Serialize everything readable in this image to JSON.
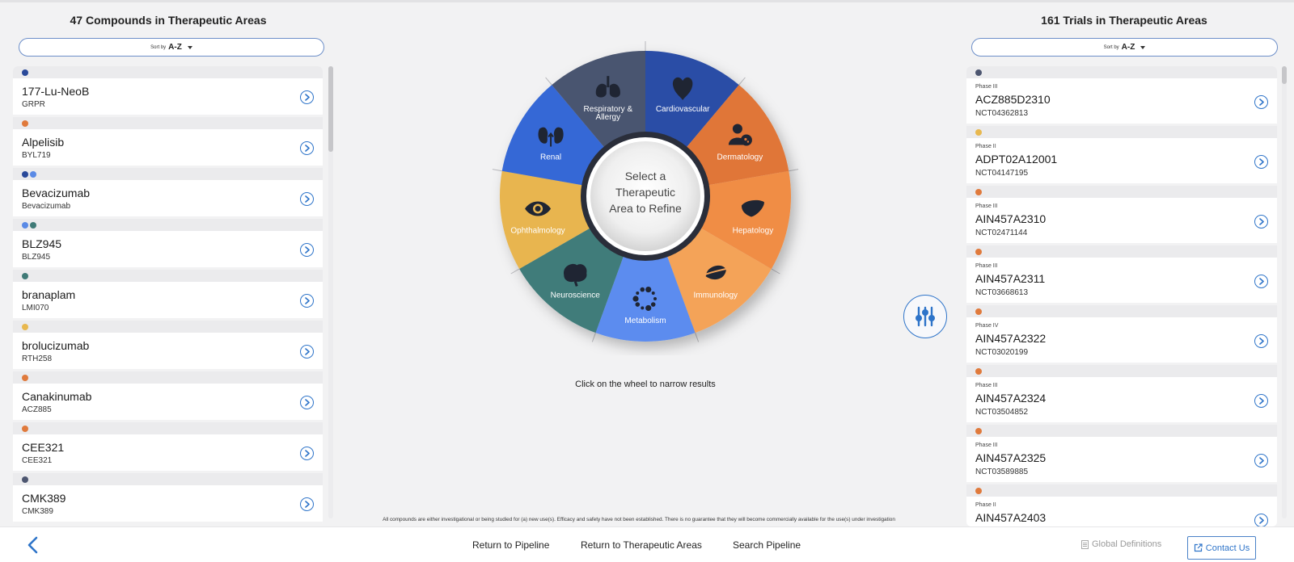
{
  "compounds": {
    "title": "47 Compounds in Therapeutic Areas",
    "sort_prefix": "Sort by",
    "sort_value": "A-Z",
    "items": [
      {
        "name": "177-Lu-NeoB",
        "code": "GRPR",
        "dots": [
          "#2a4a9a"
        ]
      },
      {
        "name": "Alpelisib",
        "code": "BYL719",
        "dots": [
          "#e07a3c"
        ]
      },
      {
        "name": "Bevacizumab",
        "code": "Bevacizumab",
        "dots": [
          "#2a4a9a",
          "#5a8ae6"
        ]
      },
      {
        "name": "BLZ945",
        "code": "BLZ945",
        "dots": [
          "#5a8ae6",
          "#3f7a77"
        ]
      },
      {
        "name": "branaplam",
        "code": "LMI070",
        "dots": [
          "#3f7a77"
        ]
      },
      {
        "name": "brolucizumab",
        "code": "RTH258",
        "dots": [
          "#e8b84f"
        ]
      },
      {
        "name": "Canakinumab",
        "code": "ACZ885",
        "dots": [
          "#e07a3c"
        ]
      },
      {
        "name": "CEE321",
        "code": "CEE321",
        "dots": [
          "#e07a3c"
        ]
      },
      {
        "name": "CMK389",
        "code": "CMK389",
        "dots": [
          "#4d5670"
        ]
      }
    ]
  },
  "trials": {
    "title": "161 Trials in Therapeutic Areas",
    "sort_prefix": "Sort by",
    "sort_value": "A-Z",
    "items": [
      {
        "phase": "Phase III",
        "name": "ACZ885D2310",
        "nct": "NCT04362813",
        "dot": "#4d5670"
      },
      {
        "phase": "Phase II",
        "name": "ADPT02A12001",
        "nct": "NCT04147195",
        "dot": "#e8b84f"
      },
      {
        "phase": "Phase III",
        "name": "AIN457A2310",
        "nct": "NCT02471144",
        "dot": "#e07a3c"
      },
      {
        "phase": "Phase III",
        "name": "AIN457A2311",
        "nct": "NCT03668613",
        "dot": "#e07a3c"
      },
      {
        "phase": "Phase IV",
        "name": "AIN457A2322",
        "nct": "NCT03020199",
        "dot": "#e07a3c"
      },
      {
        "phase": "Phase III",
        "name": "AIN457A2324",
        "nct": "NCT03504852",
        "dot": "#e07a3c"
      },
      {
        "phase": "Phase III",
        "name": "AIN457A2325",
        "nct": "NCT03589885",
        "dot": "#e07a3c"
      },
      {
        "phase": "Phase II",
        "name": "AIN457A2403",
        "nct": "",
        "dot": "#e07a3c"
      }
    ]
  },
  "wheel": {
    "center_line1": "Select a",
    "center_line2": "Therapeutic",
    "center_line3": "Area to Refine",
    "hint": "Click on the wheel to narrow results",
    "segments": [
      {
        "label": "Cardiovascular",
        "color": "#2b4ea6",
        "icon": "heart-icon"
      },
      {
        "label": "Dermatology",
        "color": "#e07638",
        "icon": "dermatology-icon"
      },
      {
        "label": "Hepatology",
        "color": "#f08d45",
        "icon": "liver-icon"
      },
      {
        "label": "Immunology",
        "color": "#f4a359",
        "icon": "immunology-icon"
      },
      {
        "label": "Metabolism",
        "color": "#5b8cef",
        "icon": "metabolism-icon"
      },
      {
        "label": "Neuroscience",
        "color": "#3f7c7a",
        "icon": "brain-icon"
      },
      {
        "label": "Ophthalmology",
        "color": "#e8b54f",
        "icon": "eye-icon"
      },
      {
        "label": "Renal",
        "color": "#3568d6",
        "icon": "kidney-icon"
      },
      {
        "label": "Respiratory & Allergy",
        "color": "#4a5470",
        "icon": "lungs-icon"
      }
    ]
  },
  "disclaimer": "All compounds are either investigational or being studied for (a) new use(s). Efficacy and safety have not been established. There is no guarantee that they will become commercially available for the use(s) under investigation",
  "footer": {
    "return_pipeline": "Return to Pipeline",
    "return_areas": "Return to Therapeutic Areas",
    "search_pipeline": "Search Pipeline",
    "global_definitions": "Global Definitions",
    "contact_us": "Contact Us"
  },
  "colors": {
    "accent": "#2e74c9"
  }
}
